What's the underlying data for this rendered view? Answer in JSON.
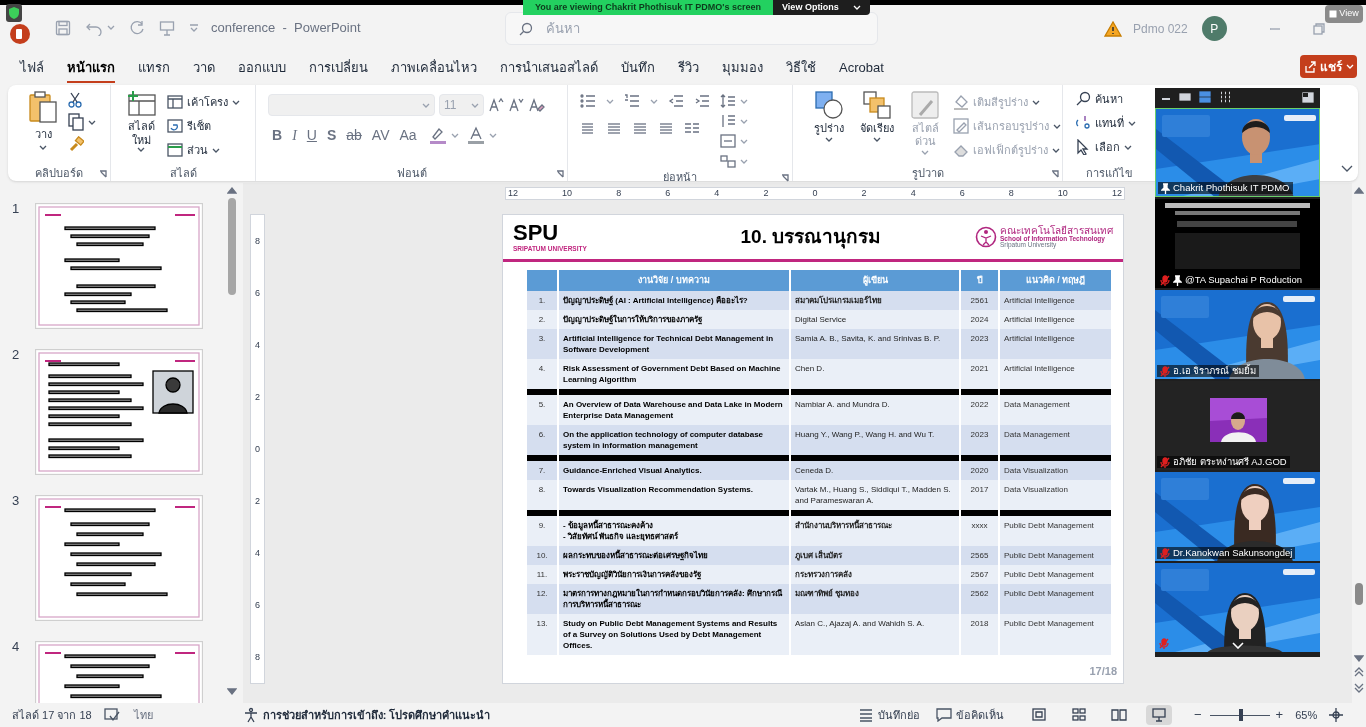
{
  "screen_share_banner": {
    "message": "You are viewing Chakrit Phothisuk IT PDMO's screen",
    "options_button": "View Options"
  },
  "view_button": "View",
  "window": {
    "title": "conference  -  PowerPoint",
    "search_placeholder": "ค้นหา",
    "account_name": "Pdmo 022",
    "avatar_initial": "P"
  },
  "tabs": [
    {
      "label": "ไฟล์",
      "selected": false
    },
    {
      "label": "หน้าแรก",
      "selected": true
    },
    {
      "label": "แทรก",
      "selected": false
    },
    {
      "label": "วาด",
      "selected": false
    },
    {
      "label": "ออกแบบ",
      "selected": false
    },
    {
      "label": "การเปลี่ยน",
      "selected": false
    },
    {
      "label": "ภาพเคลื่อนไหว",
      "selected": false
    },
    {
      "label": "การนำเสนอสไลด์",
      "selected": false
    },
    {
      "label": "บันทึก",
      "selected": false
    },
    {
      "label": "รีวิว",
      "selected": false
    },
    {
      "label": "มุมมอง",
      "selected": false
    },
    {
      "label": "วิธีใช้",
      "selected": false
    },
    {
      "label": "Acrobat",
      "selected": false
    }
  ],
  "share_button": "แชร์",
  "ribbon": {
    "groups": [
      {
        "label": "คลิปบอร์ด",
        "dialog_launcher": true,
        "buttons": [
          {
            "label": "วาง",
            "disabled": false
          }
        ]
      },
      {
        "label": "สไลด์",
        "dialog_launcher": false,
        "buttons": [
          {
            "label": "สไลด์ใหม่",
            "disabled": false
          },
          {
            "label": "เค้าโครง",
            "disabled": false
          },
          {
            "label": "รีเซ็ต",
            "disabled": false
          },
          {
            "label": "ส่วน",
            "disabled": false
          }
        ]
      },
      {
        "label": "ฟอนต์",
        "dialog_launcher": true,
        "font_size": "11",
        "buttons": [
          {
            "label": "B",
            "disabled": false
          },
          {
            "label": "I",
            "disabled": false
          },
          {
            "label": "U",
            "disabled": false
          },
          {
            "label": "S",
            "disabled": false
          },
          {
            "label": "ab",
            "disabled": false
          },
          {
            "label": "AV",
            "disabled": false
          },
          {
            "label": "Aa",
            "disabled": false
          }
        ]
      },
      {
        "label": "ย่อหน้า",
        "dialog_launcher": true
      },
      {
        "label": "รูปวาด",
        "dialog_launcher": true,
        "buttons": [
          {
            "label": "รูปร่าง",
            "disabled": false
          },
          {
            "label": "จัดเรียง",
            "disabled": false
          },
          {
            "label": "สไตล์ด่วน",
            "disabled": true
          },
          {
            "label": "เติมสีรูปร่าง",
            "disabled": true
          },
          {
            "label": "เส้นกรอบรูปร่าง",
            "disabled": true
          },
          {
            "label": "เอฟเฟ็กต์รูปร่าง",
            "disabled": true
          }
        ]
      },
      {
        "label": "การแก้ไข",
        "dialog_launcher": false,
        "buttons": [
          {
            "label": "ค้นหา",
            "disabled": false
          },
          {
            "label": "แทนที่",
            "disabled": false
          },
          {
            "label": "เลือก",
            "disabled": false
          }
        ]
      }
    ]
  },
  "slides_pane": {
    "thumbnails": [
      {
        "number": "1"
      },
      {
        "number": "2"
      },
      {
        "number": "3"
      },
      {
        "number": "4"
      }
    ]
  },
  "ruler": {
    "horizontal": [
      "12",
      "10",
      "8",
      "6",
      "4",
      "2",
      "0",
      "2",
      "4",
      "6",
      "8",
      "10",
      "12"
    ],
    "vertical": [
      "8",
      "6",
      "4",
      "2",
      "0",
      "2",
      "4",
      "6",
      "8"
    ]
  },
  "slide": {
    "logo": "SPU",
    "logo_subtitle": "SRIPATUM UNIVERSITY",
    "title": "10. บรรณานุกรม",
    "faculty_name": "คณะเทคโนโลยีสารสนเทศ",
    "faculty_english": "School of Information Technology",
    "university_english": "Sripatum University",
    "page": "17/18",
    "table": {
      "columns": [
        "งานวิจัย / บทความ",
        "ผู้เขียน",
        "ปี",
        "แนวคิด / ทฤษฎี"
      ],
      "groups": [
        [
          {
            "number": "1.",
            "title": "ปัญญาประดิษฐ์ (AI : Artificial Intelligence) คืออะไร?",
            "author": "สมาคมโปรแกรมเมอร์ไทย",
            "author_bold": true,
            "year": "2561",
            "concept": "Artificial Intelligence",
            "shaded": true
          },
          {
            "number": "2.",
            "title": "ปัญญาประดิษฐ์ในการให้บริการของภาครัฐ",
            "author": "Digital Service",
            "author_bold": false,
            "year": "2024",
            "concept": "Artificial Intelligence",
            "shaded": false
          },
          {
            "number": "3.",
            "title": "Artificial Intelligence for Technical Debt Management in Software Development",
            "author": "Samia A. B., Savita, K. and Srinivas B. P.",
            "author_bold": false,
            "year": "2023",
            "concept": "Artificial Intelligence",
            "shaded": true
          },
          {
            "number": "4.",
            "title": "Risk Assessment of Government Debt Based on Machine Learning Algorithm",
            "author": "Chen D.",
            "author_bold": false,
            "year": "2021",
            "concept": "Artificial Intelligence",
            "shaded": false
          }
        ],
        [
          {
            "number": "5.",
            "title": "An Overview of Data Warehouse and Data Lake in Modern Enterprise Data Management",
            "author": "Nambiar A. and Mundra D.",
            "author_bold": false,
            "year": "2022",
            "concept": "Data Management",
            "shaded": false
          },
          {
            "number": "6.",
            "title": "On the application technology of computer database system in information management",
            "author": "Huang Y., Wang P., Wang H. and Wu T.",
            "author_bold": false,
            "year": "2023",
            "concept": "Data Management",
            "shaded": true
          }
        ],
        [
          {
            "number": "7.",
            "title": "Guidance-Enriched Visual Analytics.",
            "author": "Ceneda D.",
            "author_bold": false,
            "year": "2020",
            "concept": "Data Visualization",
            "shaded": true
          },
          {
            "number": "8.",
            "title": "Towards Visualization Recommendation Systems.",
            "author": "Vartak M., Huang S., Siddiqui T., Madden S. and Parameswaran A.",
            "author_bold": false,
            "year": "2017",
            "concept": "Data Visualization",
            "shaded": false
          }
        ],
        [
          {
            "number": "9.",
            "title": "- ข้อมูลหนี้สาธารณะคงค้าง\n- วิสัยทัศน์ พันธกิจ และยุทธศาสตร์",
            "author": "สำนักงานบริหารหนี้สาธารณะ",
            "author_bold": true,
            "year": "xxxx",
            "concept": "Public Debt Management",
            "shaded": false
          },
          {
            "number": "10.",
            "title": "ผลกระทบของหนี้สาธารณะต่อเศรษฐกิจไทย",
            "author": "ภูเบศ เส็นบัตร",
            "author_bold": true,
            "year": "2565",
            "concept": "Public Debt Management",
            "shaded": true
          },
          {
            "number": "11.",
            "title": "พระราชบัญญัติวินัยการเงินการคลังของรัฐ",
            "author": "กระทรวงการคลัง",
            "author_bold": true,
            "year": "2567",
            "concept": "Public Debt Management",
            "shaded": false
          },
          {
            "number": "12.",
            "title": "มาตรการทางกฎหมายในการกำหนดกรอบวินัยการคลัง: ศึกษากรณีการบริหารหนี้สาธารณะ",
            "author": "มณฑาทิพย์ ชุมทอง",
            "author_bold": true,
            "year": "2562",
            "concept": "Public Debt Management",
            "shaded": true
          },
          {
            "number": "13.",
            "title": "Study on Public Debt Management Systems and Results of a Survey on Solutions Used by Debt Management Offices.",
            "author": "Aslan C., Ajazaj A. and Wahidh S. A.",
            "author_bold": false,
            "year": "2018",
            "concept": "Public Debt Management",
            "shaded": false
          }
        ]
      ]
    }
  },
  "video_panel": {
    "participants": [
      {
        "name": "Chakrit Phothisuk IT PDMO",
        "muted": false,
        "pinned": true,
        "kind": "camera"
      },
      {
        "name": "@TA Supachai P Roduction",
        "muted": true,
        "pinned": true,
        "kind": "dark"
      },
      {
        "name": "อ.เอ จิราภรณ์ ชมยิ้ม",
        "muted": true,
        "pinned": false,
        "kind": "camera"
      },
      {
        "name": "อภิชัย ตระหง่านศรี AJ.GOD",
        "muted": true,
        "pinned": false,
        "kind": "inset"
      },
      {
        "name": "Dr.Kanokwan Sakunsongdej",
        "muted": true,
        "pinned": false,
        "kind": "camera"
      },
      {
        "muted": true,
        "pinned": false,
        "kind": "camera"
      }
    ]
  },
  "status_bar": {
    "slide_counter": "สไลด์ 17 จาก 18",
    "language": "ไทย",
    "accessibility": "การช่วยสำหรับการเข้าถึง: โปรดศึกษาคำแนะนำ",
    "notes": "บันทึกย่อ",
    "comments": "ข้อคิดเห็น",
    "view_modes": [
      {
        "selected": false
      },
      {
        "selected": false
      },
      {
        "selected": false
      },
      {
        "selected": true
      }
    ],
    "zoom_out": "−",
    "zoom_in": "+",
    "zoom": {
      "level": 0.53,
      "reading": "65%"
    }
  }
}
